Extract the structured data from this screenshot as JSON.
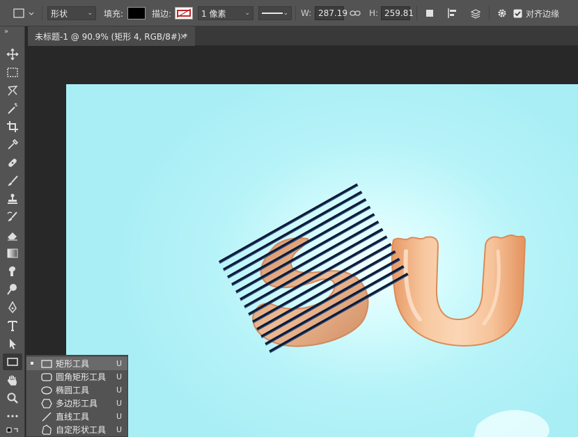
{
  "options_bar": {
    "tool_mode": "形状",
    "fill_label": "填充:",
    "fill_color": "#000000",
    "stroke_label": "描边:",
    "stroke_width": "1 像素",
    "w_label": "W:",
    "w_value": "287.19",
    "h_label": "H:",
    "h_value": "259.81",
    "align_edges_label": "对齐边缘",
    "align_edges_checked": true
  },
  "document_tab": {
    "title": "未标题-1 @ 90.9% (矩形 4, RGB/8#) *",
    "close_glyph": "×"
  },
  "toolbar": {
    "collapse_glyph": "»",
    "tools": [
      "move-tool",
      "marquee-tool",
      "lasso-tool",
      "magic-wand-tool",
      "crop-tool",
      "eyedropper-tool",
      "healing-brush-tool",
      "brush-tool",
      "clone-stamp-tool",
      "history-brush-tool",
      "eraser-tool",
      "gradient-tool",
      "smudge-tool",
      "dodge-tool",
      "pen-tool",
      "type-tool",
      "path-selection-tool",
      "rectangle-tool",
      "hand-tool",
      "zoom-tool",
      "more-tools"
    ],
    "active_tool": "rectangle-tool"
  },
  "flyout": {
    "items": [
      {
        "label": "矩形工具",
        "key": "U",
        "icon": "rectangle-icon",
        "selected": true
      },
      {
        "label": "圆角矩形工具",
        "key": "U",
        "icon": "rounded-rectangle-icon",
        "selected": false
      },
      {
        "label": "椭圆工具",
        "key": "U",
        "icon": "ellipse-icon",
        "selected": false
      },
      {
        "label": "多边形工具",
        "key": "U",
        "icon": "polygon-icon",
        "selected": false
      },
      {
        "label": "直线工具",
        "key": "U",
        "icon": "line-icon",
        "selected": false
      },
      {
        "label": "自定形状工具",
        "key": "U",
        "icon": "custom-shape-icon",
        "selected": false
      }
    ]
  },
  "canvas": {
    "background_color": "#b5f3f8",
    "letter_color": "#f1b98c",
    "stripe_color": "#0e1a36",
    "stripe_count": 13
  }
}
